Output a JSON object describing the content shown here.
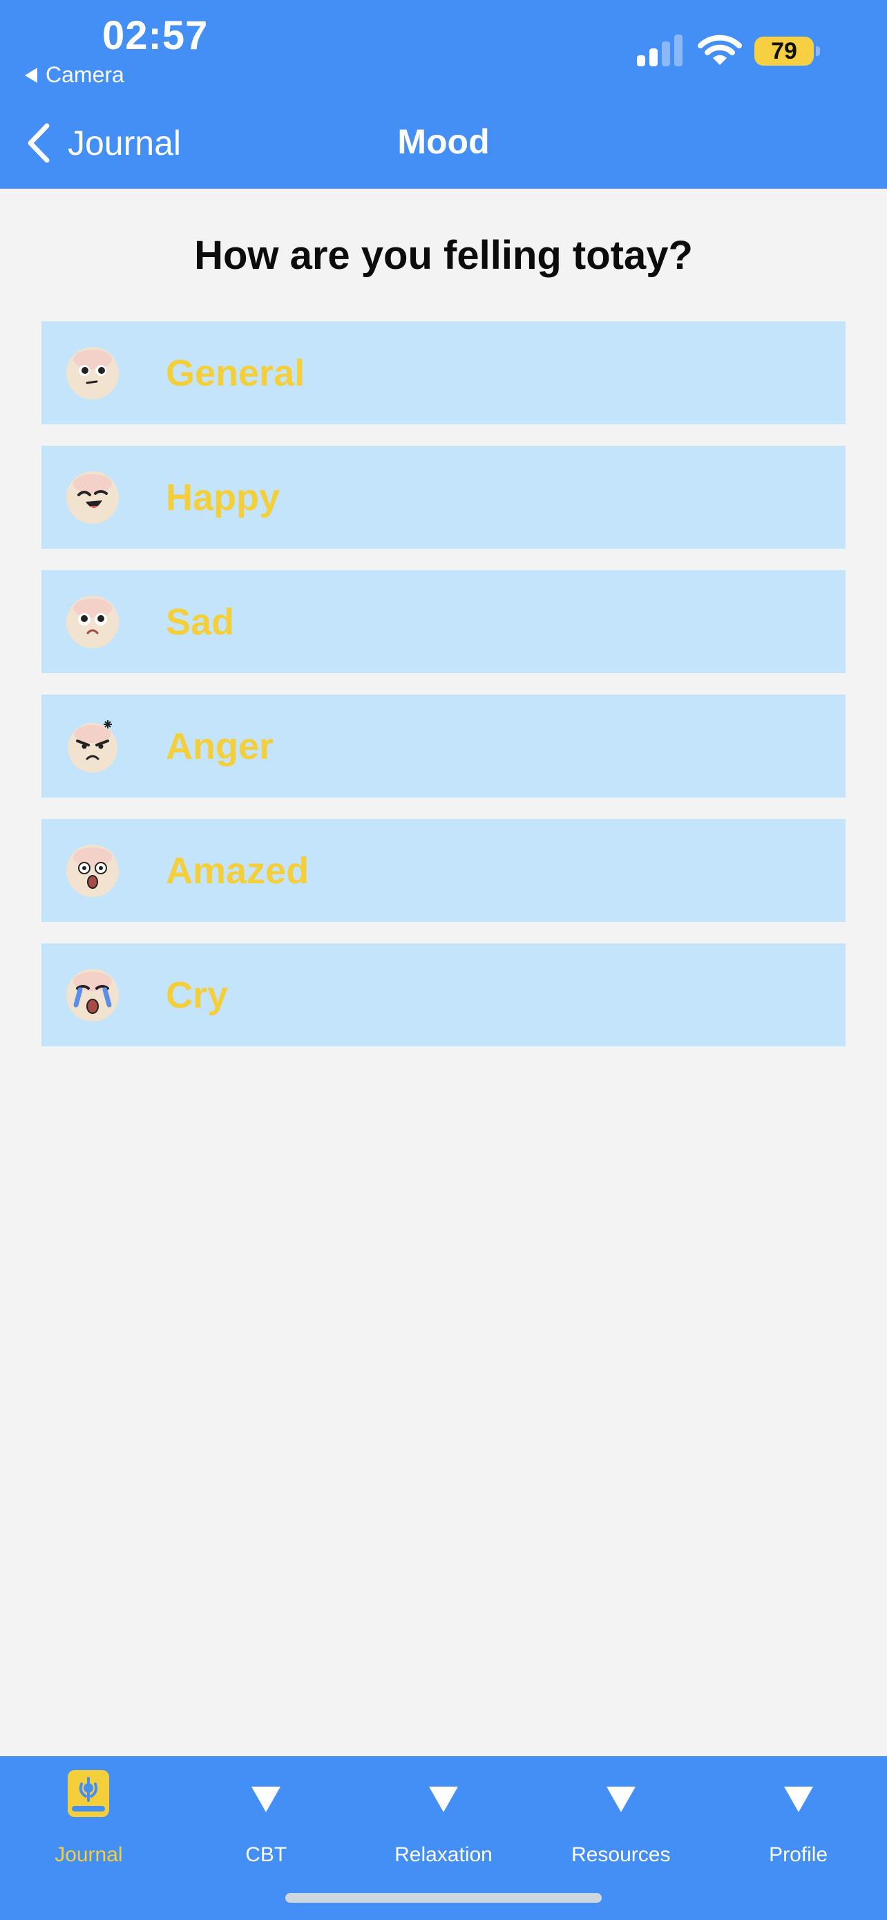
{
  "status_bar": {
    "time": "02:57",
    "back_app": "Camera",
    "battery": "79"
  },
  "nav": {
    "back_label": "Journal",
    "title": "Mood"
  },
  "question": "How are you felling totay?",
  "moods": [
    {
      "label": "General",
      "icon": "neutral-face-icon"
    },
    {
      "label": "Happy",
      "icon": "happy-face-icon"
    },
    {
      "label": "Sad",
      "icon": "sad-face-icon"
    },
    {
      "label": "Anger",
      "icon": "angry-face-icon"
    },
    {
      "label": "Amazed",
      "icon": "amazed-face-icon"
    },
    {
      "label": "Cry",
      "icon": "crying-face-icon"
    }
  ],
  "tabs": [
    {
      "label": "Journal",
      "icon": "journal-book-icon",
      "active": true
    },
    {
      "label": "CBT",
      "icon": "triangle-down-icon"
    },
    {
      "label": "Relaxation",
      "icon": "triangle-down-icon"
    },
    {
      "label": "Resources",
      "icon": "triangle-down-icon"
    },
    {
      "label": "Profile",
      "icon": "triangle-down-icon"
    }
  ],
  "colors": {
    "primary": "#448ff6",
    "row_background": "#c3e4fa",
    "mood_label": "#f4cf3a",
    "page_background": "#f3f3f3"
  }
}
